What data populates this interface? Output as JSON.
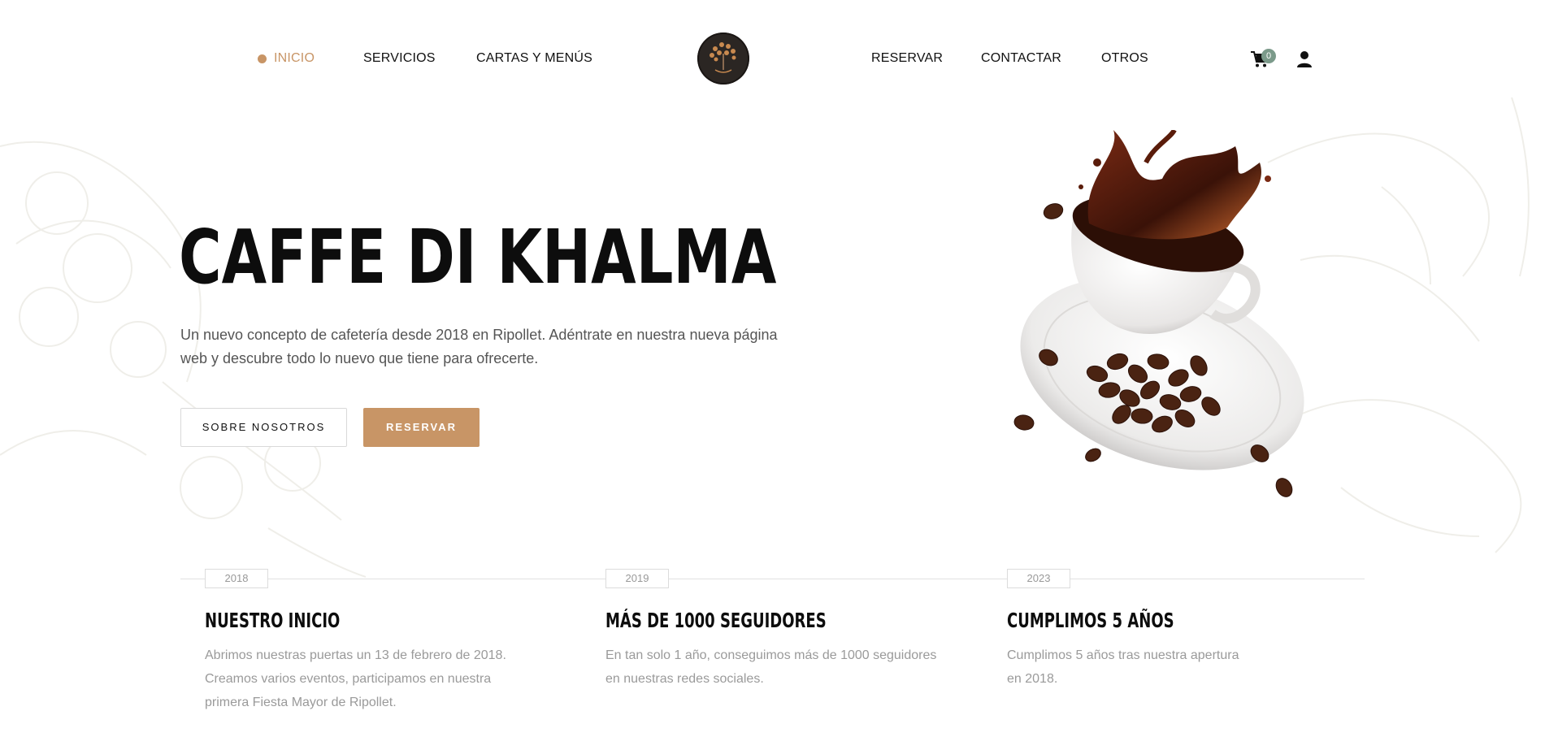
{
  "nav": {
    "left_items": [
      {
        "label": "INICIO",
        "active": true
      },
      {
        "label": "SERVICIOS",
        "active": false
      },
      {
        "label": "CARTAS Y MENÚS",
        "active": false
      }
    ],
    "right_items": [
      {
        "label": "RESERVAR"
      },
      {
        "label": "CONTACTAR"
      },
      {
        "label": "OTROS"
      }
    ],
    "cart_count": "0",
    "logo_icon": "coffee-tree-logo",
    "cart_icon": "cart-icon",
    "user_icon": "user-icon"
  },
  "hero": {
    "title": "CAFFE DI KHALMA",
    "description": "Un nuevo concepto de cafetería desde 2018 en Ripollet. Adéntrate en nuestra nueva página web y descubre todo lo nuevo que tiene para ofrecerte.",
    "primary_button": "SOBRE NOSOTROS",
    "secondary_button": "RESERVAR",
    "image": "coffee-cup-splash-with-beans"
  },
  "timeline": [
    {
      "year": "2018",
      "title": "NUESTRO INICIO",
      "text": "Abrimos nuestras puertas un 13 de febrero de 2018. Creamos varios eventos, participamos en nuestra primera Fiesta Mayor de Ripollet."
    },
    {
      "year": "2019",
      "title": "MÁS DE 1000 SEGUIDORES",
      "text": "En tan solo 1 año, conseguimos más de 1000 seguidores en nuestras redes sociales."
    },
    {
      "year": "2023",
      "title": "CUMPLIMOS 5 AÑOS",
      "text": "Cumplimos 5 años tras nuestra apertura en 2018."
    }
  ],
  "colors": {
    "accent": "#c89566",
    "badge": "#7b9a8a",
    "text": "#111111",
    "muted": "#9a9a9a"
  }
}
